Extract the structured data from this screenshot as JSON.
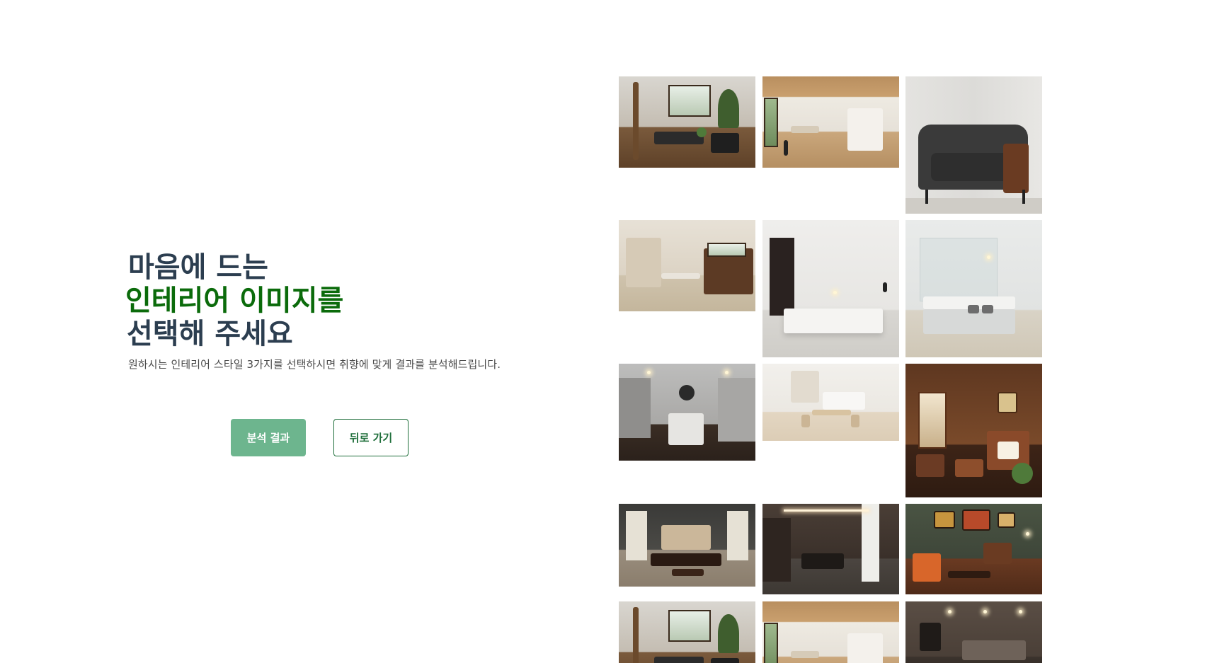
{
  "heading": {
    "line1": "마음에 드는",
    "line2": "인테리어 이미지를",
    "line3": "선택해 주세요"
  },
  "subtitle": "원하시는 인테리어 스타일 3가지를 선택하시면 취향에 맞게 결과를 분석해드립니다.",
  "buttons": {
    "result": "분석 결과",
    "back": "뒤로 가기"
  },
  "colors": {
    "heading": "#2c3e50",
    "accent": "#0b6b0b",
    "result_button": "#6db58e",
    "back_border": "#1e6e3a"
  },
  "gallery": {
    "images": [
      "modern-living-room-wood-floor",
      "wood-ceiling-kitchen-hallway",
      "charcoal-armchair",
      "kitchen-island-wood-cabinets",
      "minimal-white-bedroom",
      "white-kitchen-bar-stools",
      "gray-kitchen-chandelier",
      "white-dining-kitchen",
      "classic-wood-paneled-living-room",
      "asian-style-living-room",
      "dark-wood-minimal-kitchen",
      "vintage-eclectic-lounge",
      "modern-living-room-wood-floor",
      "wood-ceiling-kitchen-hallway",
      "dark-modern-living-room"
    ]
  }
}
